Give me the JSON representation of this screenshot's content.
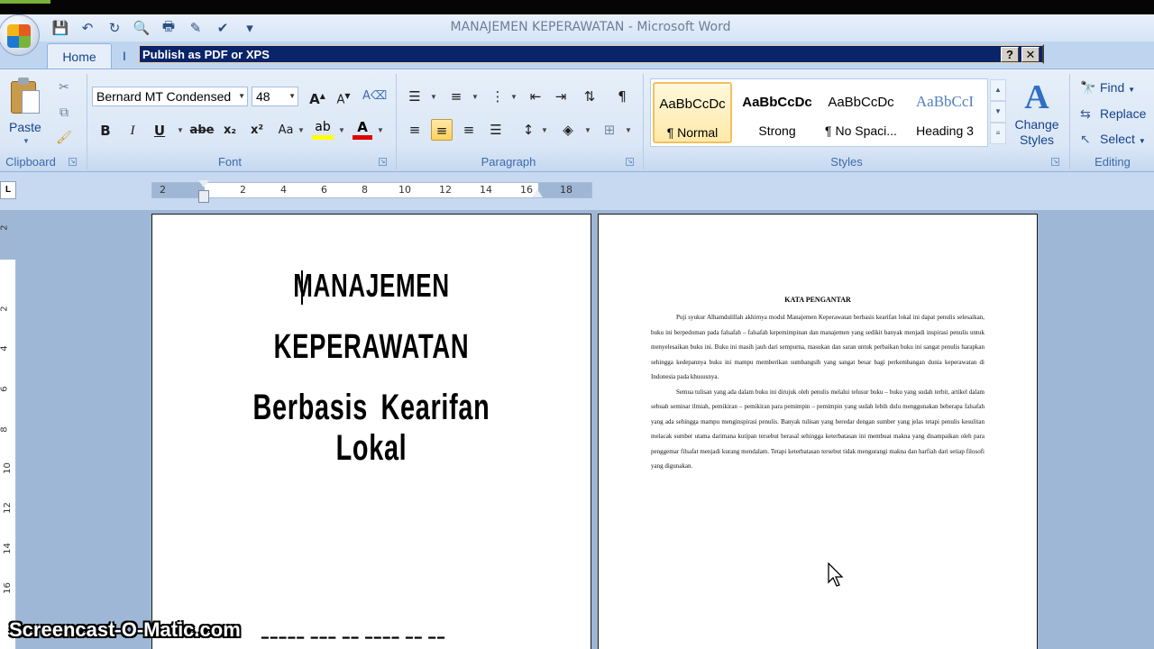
{
  "window": {
    "title": "MANAJEMEN KEPERAWATAN - Microsoft Word"
  },
  "tabs": {
    "home": "Home",
    "insert_partial": "I"
  },
  "dialog": {
    "title": "Publish as PDF or XPS",
    "help": "?",
    "close": "✕"
  },
  "clipboard": {
    "paste_label": "Paste",
    "group_label": "Clipboard"
  },
  "font": {
    "name": "Bernard MT Condensed",
    "size": "48",
    "group_label": "Font",
    "bold": "B",
    "italic": "I",
    "underline": "U",
    "strike": "abe",
    "subscript": "x₂",
    "superscript": "x²",
    "change_case": "Aa",
    "grow": "A",
    "shrink": "A"
  },
  "paragraph": {
    "group_label": "Paragraph"
  },
  "styles": {
    "group_label": "Styles",
    "items": [
      {
        "sample": "AaBbCcDc",
        "name": "¶ Normal"
      },
      {
        "sample": "AaBbCcDc",
        "name": "Strong"
      },
      {
        "sample": "AaBbCcDc",
        "name": "¶ No Spaci..."
      },
      {
        "sample": "AaBbCcI",
        "name": "Heading 3"
      }
    ],
    "change_styles": "Change Styles"
  },
  "editing": {
    "group_label": "Editing",
    "find": "Find",
    "replace": "Replace",
    "select": "Select"
  },
  "ruler": {
    "ticks": [
      "2",
      "2",
      "4",
      "6",
      "8",
      "10",
      "12",
      "14",
      "16",
      "18"
    ],
    "vticks": [
      "2",
      "2",
      "4",
      "6",
      "8",
      "10",
      "12",
      "14",
      "16"
    ]
  },
  "page1": {
    "line1": "MANAJEMEN",
    "line2": "KEPERAWATAN",
    "line3": "Berbasis Kearifan Lokal"
  },
  "page2": {
    "heading": "KATA PENGANTAR",
    "para1": "Puji syukur Alhamdulillah akhirnya modul Manajemen Keperawatan berbasis kearifan lokal ini dapat penulis selesaikan, buku ini berpedoman pada falsafah – falsafah kepemimpinan dan manajemen yang sedikit banyak menjadi inspirasi penulis untuk menyelesaikan buku ini. Buku ini masih jauh dari sempurna, masukan dan saran untuk perbaikan buku ini sangat penulis harapkan sehingga kedepannya buku ini mampu memberikan sumbangsih yang sangat besar bagi perkembangan dunia keperawatan di Indonesia pada khususnya.",
    "para2": "Semua tulisan yang ada dalam buku ini dirujuk oleh penulis melalui telusur buku – buku yang sudah terbit, artikel dalam sebuah seminar ilmiah, pemikiran – pemikiran para pemimpin – pemimpin yang sudah lebih dulu menggunakan beberapa falsafah yang ada sehingga mampu menginspirasi penulis. Banyak tulisan yang beredar dengan sumber yang jelas tetapi penulis kesulitan melacak sumber utama darimana kutipan tersebut berasal sehingga keterbatasan ini membuat makna yang disampaikan oleh para penggemar filsafat menjadi kurang mendalam. Tetapi keterbatasan tersebut tidak mengurangi makna dan harfiah dari setiap filosofi yang digunakan."
  },
  "watermark": "Screencast-O-Matic.com"
}
